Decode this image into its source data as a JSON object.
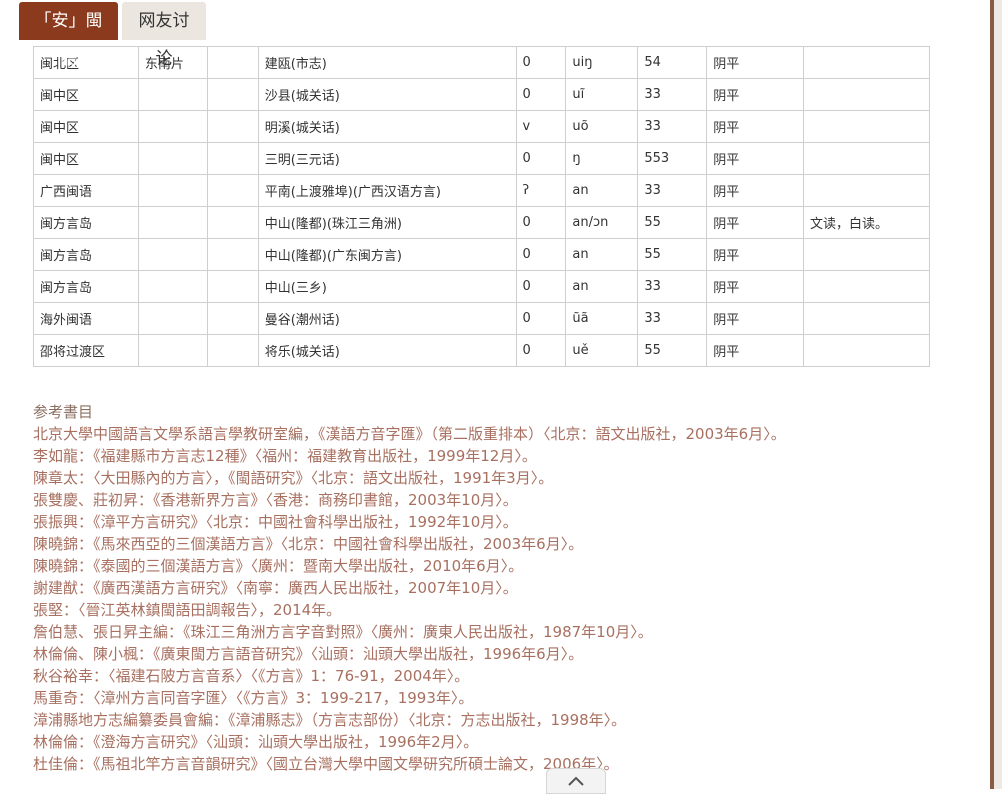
{
  "tabs": [
    {
      "label": "「安」閩語",
      "active": true
    },
    {
      "label": "网友讨论",
      "active": false
    }
  ],
  "table": {
    "rows": [
      [
        "闽北区",
        "东南片",
        "",
        "建瓯(市志)",
        "0",
        "uiŋ",
        "54",
        "阴平",
        ""
      ],
      [
        "闽中区",
        "",
        "",
        "沙县(城关话)",
        "0",
        "uĩ",
        "33",
        "阴平",
        ""
      ],
      [
        "闽中区",
        "",
        "",
        "明溪(城关话)",
        "v",
        "uõ",
        "33",
        "阴平",
        ""
      ],
      [
        "闽中区",
        "",
        "",
        "三明(三元话)",
        "0",
        "ŋ",
        "553",
        "阴平",
        ""
      ],
      [
        "广西闽语",
        "",
        "",
        "平南(上渡雅埠)(广西汉语方言)",
        "ʔ",
        "an",
        "33",
        "阴平",
        ""
      ],
      [
        "闽方言岛",
        "",
        "",
        "中山(隆都)(珠江三角洲)",
        "0",
        "an/ɔn",
        "55",
        "阴平",
        "文读，白读。"
      ],
      [
        "闽方言岛",
        "",
        "",
        "中山(隆都)(广东闽方言)",
        "0",
        "an",
        "55",
        "阴平",
        ""
      ],
      [
        "闽方言岛",
        "",
        "",
        "中山(三乡)",
        "0",
        "an",
        "33",
        "阴平",
        ""
      ],
      [
        "海外闽语",
        "",
        "",
        "曼谷(潮州话)",
        "0",
        "ũã",
        "33",
        "阴平",
        ""
      ],
      [
        "邵将过渡区",
        "",
        "",
        "将乐(城关话)",
        "0",
        "uě",
        "55",
        "阴平",
        ""
      ]
    ]
  },
  "references": {
    "title": "参考書目",
    "items": [
      "北京大學中國語言文學系語言學教研室編，《漢語方音字匯》（第二版重排本）〈北京：語文出版社，2003年6月〉。",
      "李如龍：《福建縣市方言志12種》〈福州：福建教育出版社，1999年12月〉。",
      "陳章太：〈大田縣內的方言〉，《閩語研究》〈北京：語文出版社，1991年3月〉。",
      "張雙慶、莊初昇：《香港新界方言》〈香港：商務印書館，2003年10月〉。",
      "張振興：《漳平方言研究》〈北京：中國社會科學出版社，1992年10月〉。",
      "陳曉錦：《馬來西亞的三個漢語方言》〈北京：中國社會科學出版社，2003年6月〉。",
      "陳曉錦：《泰國的三個漢語方言》〈廣州：暨南大學出版社，2010年6月〉。",
      "謝建猷：《廣西漢語方言研究》〈南寧：廣西人民出版社，2007年10月〉。",
      "張堅：〈晉江英林鎮閩語田調報告〉，2014年。",
      "詹伯慧、張日昇主編：《珠江三角洲方言字音對照》〈廣州：廣東人民出版社，1987年10月〉。",
      "林倫倫、陳小楓：《廣東閩方言語音研究》〈汕頭：汕頭大學出版社，1996年6月〉。",
      "秋谷裕幸：〈福建石陂方言音系〉〈《方言》1：76-91，2004年〉。",
      "馬重奇：〈漳州方言同音字匯〉〈《方言》3：199-217，1993年〉。",
      "漳浦縣地方志編纂委員會編：《漳浦縣志》（方言志部份）〈北京：方志出版社，1998年〉。",
      "林倫倫：《澄海方言研究》〈汕頭：汕頭大學出版社，1996年2月〉。",
      "杜佳倫：《馬祖北竿方言音韻研究》〈國立台灣大學中國文學研究所碩士論文，2006年〉。"
    ]
  },
  "icons": {
    "scroll_top": "chevron-up-icon"
  },
  "colors": {
    "accent": "#8b3a1e",
    "reference_text": "#a87060"
  }
}
